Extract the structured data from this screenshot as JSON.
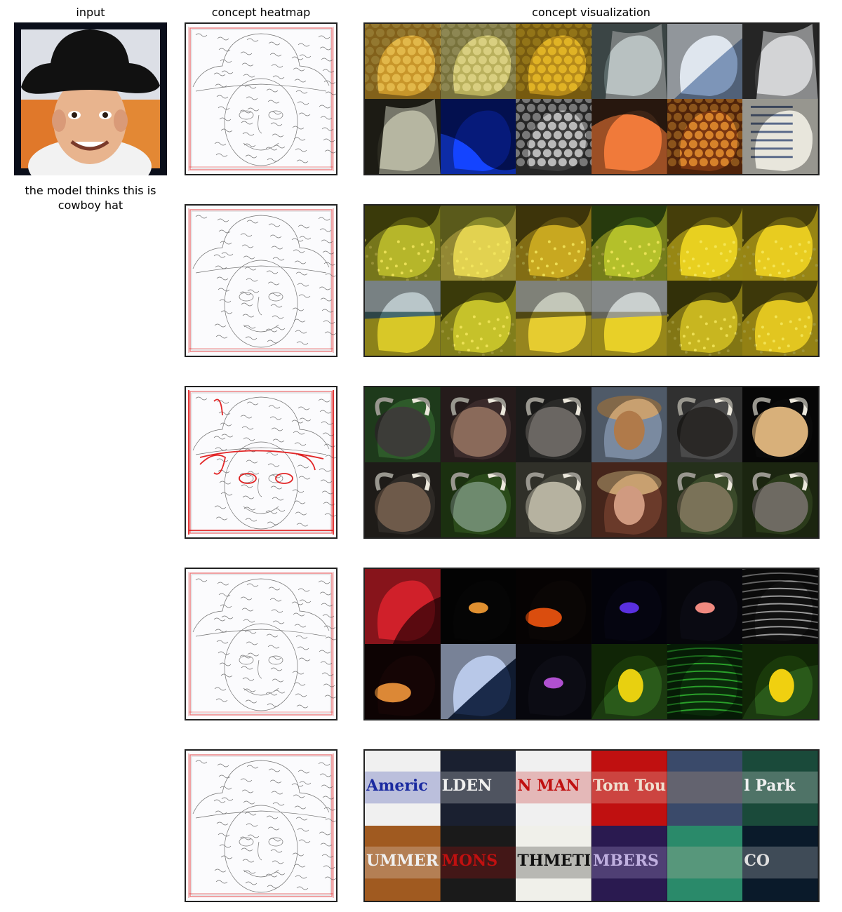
{
  "headers": {
    "input": "input",
    "heatmap": "concept heatmap",
    "visualization": "concept visualization"
  },
  "prediction_text": "the model thinks this is cowboy hat",
  "icons": [
    "boy-in-cowboy-hat-photo",
    "edge-heatmap",
    "example-patch"
  ],
  "colors": {
    "heat": "#e01010",
    "frame": "#222222",
    "background": "#ffffff"
  },
  "concepts": [
    {
      "id": "honeycomb-and-window",
      "heat_intensity": 0.35,
      "tiles": [
        {
          "c1": "#c8962a",
          "c2": "#e2b84a",
          "pattern": "honeycomb"
        },
        {
          "c1": "#b9b05c",
          "c2": "#d9cf80",
          "pattern": "honeycomb"
        },
        {
          "c1": "#b58a1a",
          "c2": "#e0b325",
          "pattern": "honeycomb"
        },
        {
          "c1": "#5b6a6a",
          "c2": "#c9d0d0",
          "pattern": "window"
        },
        {
          "c1": "#7d95b8",
          "c2": "#dfe6ee",
          "pattern": "sky"
        },
        {
          "c1": "#3a3a3a",
          "c2": "#eef0f2",
          "pattern": "window"
        },
        {
          "c1": "#2b2a20",
          "c2": "#cfcfb8",
          "pattern": "window"
        },
        {
          "c1": "#061a7a",
          "c2": "#1444ff",
          "pattern": "blue"
        },
        {
          "c1": "#3b3b3b",
          "c2": "#b9b9b9",
          "pattern": "honeycomb"
        },
        {
          "c1": "#3c2416",
          "c2": "#f07a3a",
          "pattern": "skin"
        },
        {
          "c1": "#7a3610",
          "c2": "#d6822a",
          "pattern": "honeycomb"
        },
        {
          "c1": "#6e6a5a",
          "c2": "#e8e6dc",
          "pattern": "paper"
        }
      ]
    },
    {
      "id": "yellow-rapeseed-field",
      "heat_intensity": 0.4,
      "tiles": [
        {
          "c1": "#5a5a10",
          "c2": "#b6b62a",
          "pattern": "field"
        },
        {
          "c1": "#8a8a2a",
          "c2": "#e2d250",
          "pattern": "field"
        },
        {
          "c1": "#5e5010",
          "c2": "#c8a820",
          "pattern": "field"
        },
        {
          "c1": "#3c5a14",
          "c2": "#b4c02a",
          "pattern": "field"
        },
        {
          "c1": "#6a6010",
          "c2": "#e8d020",
          "pattern": "field"
        },
        {
          "c1": "#6a6010",
          "c2": "#e8cc20",
          "pattern": "field"
        },
        {
          "c1": "#466a6e",
          "c2": "#d8c828",
          "pattern": "landscape"
        },
        {
          "c1": "#5a5a10",
          "c2": "#c6c22a",
          "pattern": "field"
        },
        {
          "c1": "#7a6e1e",
          "c2": "#e6cc30",
          "pattern": "landscape"
        },
        {
          "c1": "#9a9a8a",
          "c2": "#e8d028",
          "pattern": "landscape"
        },
        {
          "c1": "#4e4a0e",
          "c2": "#c8b620",
          "pattern": "field"
        },
        {
          "c1": "#5e5610",
          "c2": "#e2c620",
          "pattern": "field"
        }
      ]
    },
    {
      "id": "horns-and-hats",
      "heat_intensity": 0.9,
      "tiles": [
        {
          "c1": "#2e5a2a",
          "c2": "#3c3c38",
          "pattern": "animal"
        },
        {
          "c1": "#3a2a2a",
          "c2": "#8a6a5a",
          "pattern": "animal"
        },
        {
          "c1": "#2a2a28",
          "c2": "#6a6662",
          "pattern": "animal"
        },
        {
          "c1": "#7a8aa0",
          "c2": "#b07a4a",
          "pattern": "person"
        },
        {
          "c1": "#4a4a4a",
          "c2": "#2a2826",
          "pattern": "animal"
        },
        {
          "c1": "#0a0a0a",
          "c2": "#d8b07a",
          "pattern": "animal"
        },
        {
          "c1": "#2e2a26",
          "c2": "#6e5a4a",
          "pattern": "animal"
        },
        {
          "c1": "#2a4a1a",
          "c2": "#6e8a6e",
          "pattern": "animal"
        },
        {
          "c1": "#4a4a40",
          "c2": "#b6b2a0",
          "pattern": "animal"
        },
        {
          "c1": "#6a3a2a",
          "c2": "#d09a80",
          "pattern": "person"
        },
        {
          "c1": "#3a4a2a",
          "c2": "#7a7258",
          "pattern": "animal"
        },
        {
          "c1": "#2a3a1a",
          "c2": "#6e6a62",
          "pattern": "animal"
        }
      ]
    },
    {
      "id": "dark-glow-and-orchid",
      "heat_intensity": 0.3,
      "tiles": [
        {
          "c1": "#5a0a10",
          "c2": "#d0202a",
          "pattern": "red"
        },
        {
          "c1": "#050505",
          "c2": "#e09030",
          "pattern": "spot"
        },
        {
          "c1": "#0a0605",
          "c2": "#ff5a10",
          "pattern": "glow"
        },
        {
          "c1": "#050510",
          "c2": "#5a30e0",
          "pattern": "spot"
        },
        {
          "c1": "#0a0a12",
          "c2": "#f08a80",
          "pattern": "spot"
        },
        {
          "c1": "#101010",
          "c2": "#9a9a9a",
          "pattern": "stripes"
        },
        {
          "c1": "#150505",
          "c2": "#ffa040",
          "pattern": "glow"
        },
        {
          "c1": "#1a2a4a",
          "c2": "#b8c8e8",
          "pattern": "sky"
        },
        {
          "c1": "#0c0c14",
          "c2": "#b050d0",
          "pattern": "spot"
        },
        {
          "c1": "#1a3a0a",
          "c2": "#e8d010",
          "pattern": "flower"
        },
        {
          "c1": "#0a2a0a",
          "c2": "#2aa02a",
          "pattern": "stripes"
        },
        {
          "c1": "#1a3a0a",
          "c2": "#f0d010",
          "pattern": "flower"
        }
      ]
    },
    {
      "id": "bold-printed-text",
      "heat_intensity": 0.45,
      "tiles": [
        {
          "c1": "#f0f0f0",
          "c2": "#1a2aa0",
          "pattern": "text",
          "label": "Americ"
        },
        {
          "c1": "#1a2030",
          "c2": "#f0f0f0",
          "pattern": "text",
          "label": "LDEN"
        },
        {
          "c1": "#f0f0f0",
          "c2": "#c01010",
          "pattern": "text",
          "label": "N MAN"
        },
        {
          "c1": "#c01010",
          "c2": "#f0e0d0",
          "pattern": "text",
          "label": "Tom Tou"
        },
        {
          "c1": "#3a4a6a",
          "c2": "#e0b080",
          "pattern": "text",
          "label": ""
        },
        {
          "c1": "#1a4a3a",
          "c2": "#f0f0f0",
          "pattern": "text",
          "label": "l Park"
        },
        {
          "c1": "#a05a20",
          "c2": "#f0f0f0",
          "pattern": "text",
          "label": "UMMER"
        },
        {
          "c1": "#1a1a1a",
          "c2": "#c01010",
          "pattern": "text",
          "label": "MONS"
        },
        {
          "c1": "#f0f0ea",
          "c2": "#101010",
          "pattern": "text",
          "label": "THMETIC"
        },
        {
          "c1": "#2a1a50",
          "c2": "#c0b0e0",
          "pattern": "text",
          "label": "MBERS"
        },
        {
          "c1": "#2a8a6a",
          "c2": "#e0c0b0",
          "pattern": "text",
          "label": ""
        },
        {
          "c1": "#0a1a2a",
          "c2": "#e0e0e0",
          "pattern": "text",
          "label": "CO"
        }
      ]
    }
  ]
}
